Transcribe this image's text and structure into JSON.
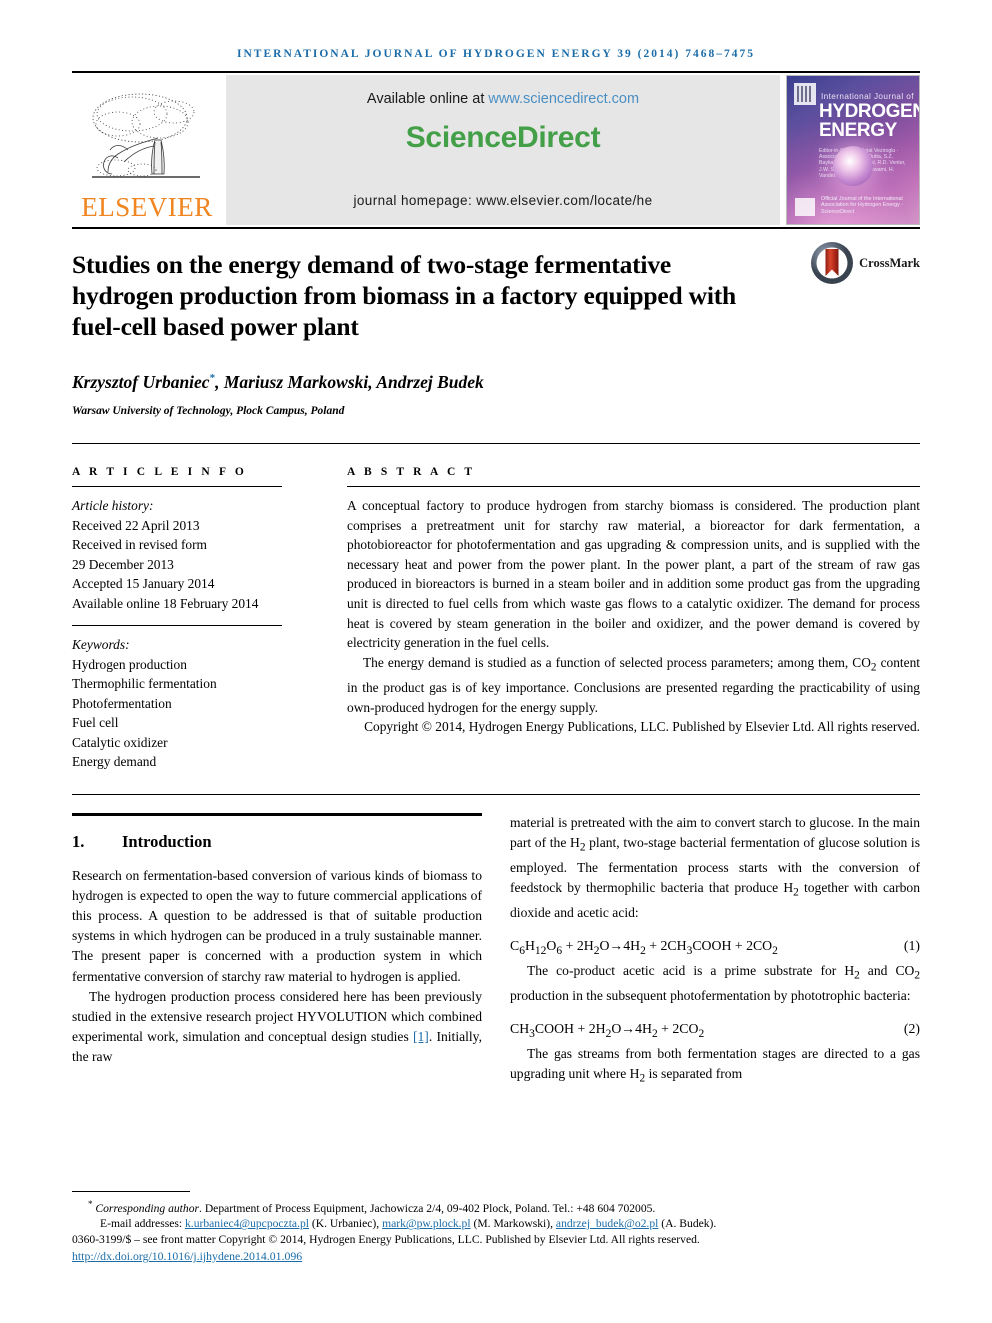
{
  "running_head": "INTERNATIONAL JOURNAL OF HYDROGEN ENERGY 39 (2014) 7468–7475",
  "masthead": {
    "publisher_word": "ELSEVIER",
    "available_prefix": "Available online at ",
    "available_url": "www.sciencedirect.com",
    "sciencedirect_logo": "ScienceDirect",
    "journal_homepage": "journal homepage: www.elsevier.com/locate/he",
    "cover": {
      "top_line": "International Journal of",
      "title_line1": "HYDROGEN",
      "title_line2": "ENERGY",
      "editors": "Editor-in-Chief: T. Nejat Veziroglu  ·  Associate Editors: S. Dutta, S.Z. Baykara, H.K. Abdel-Aal, R.D. Venter, J.W. Sheffield, D.Y. Goswami, H. Vandenborre",
      "footer": "Official Journal of the International Association for Hydrogen Energy  ·  ScienceDirect"
    }
  },
  "title": "Studies on the energy demand of two-stage fermentative hydrogen production from biomass in a factory equipped with fuel-cell based power plant",
  "crossmark_label": "CrossMark",
  "authors": "Krzysztof Urbaniec",
  "authors_rest": ", Mariusz Markowski, Andrzej Budek",
  "author_marker": "*",
  "affiliation": "Warsaw University of Technology, Plock Campus, Poland",
  "article_info": {
    "heading": "A R T I C L E   I N F O",
    "history_label": "Article history:",
    "history": [
      "Received 22 April 2013",
      "Received in revised form",
      "29 December 2013",
      "Accepted 15 January 2014",
      "Available online 18 February 2014"
    ],
    "keywords_label": "Keywords:",
    "keywords": [
      "Hydrogen production",
      "Thermophilic fermentation",
      "Photofermentation",
      "Fuel cell",
      "Catalytic oxidizer",
      "Energy demand"
    ]
  },
  "abstract": {
    "heading": "A B S T R A C T",
    "paragraph1": "A conceptual factory to produce hydrogen from starchy biomass is considered. The production plant comprises a pretreatment unit for starchy raw material, a bioreactor for dark fermentation, a photobioreactor for photofermentation and gas upgrading & compression units, and is supplied with the necessary heat and power from the power plant. In the power plant, a part of the stream of raw gas produced in bioreactors is burned in a steam boiler and in addition some product gas from the upgrading unit is directed to fuel cells from which waste gas flows to a catalytic oxidizer. The demand for process heat is covered by steam generation in the boiler and oxidizer, and the power demand is covered by electricity generation in the fuel cells.",
    "paragraph2_a": "The energy demand is studied as a function of selected process parameters; among them, CO",
    "paragraph2_sub": "2",
    "paragraph2_b": " content in the product gas is of key importance. Conclusions are presented regarding the practicability of using own-produced hydrogen for the energy supply.",
    "copyright": "Copyright © 2014, Hydrogen Energy Publications, LLC. Published by Elsevier Ltd. All rights reserved."
  },
  "body": {
    "section_number": "1.",
    "section_title": "Introduction",
    "left_p1": "Research on fermentation-based conversion of various kinds of biomass to hydrogen is expected to open the way to future commercial applications of this process. A question to be addressed is that of suitable production systems in which hydrogen can be produced in a truly sustainable manner. The present paper is concerned with a production system in which fermentative conversion of starchy raw material to hydrogen is applied.",
    "left_p2_a": "The hydrogen production process considered here has been previously studied in the extensive research project HYVOLUTION which combined experimental work, simulation and conceptual design studies ",
    "left_p2_ref": "[1]",
    "left_p2_b": ". Initially, the raw",
    "right_p1_a": "material is pretreated with the aim to convert starch to glucose. In the main part of the H",
    "right_p1_sub": "2",
    "right_p1_b": " plant, two-stage bacterial fermentation of glucose solution is employed. The fermentation process starts with the conversion of feedstock by thermophilic bacteria that produce H",
    "right_p1_sub2": "2",
    "right_p1_c": " together with carbon dioxide and acetic acid:",
    "equation1": "C6H12O6 + 2H2O → 4H2 + 2CH3COOH + 2CO2",
    "equation1_number": "(1)",
    "right_p2_a": "The co-product acetic acid is a prime substrate for H",
    "right_p2_sub": "2",
    "right_p2_b": " and CO",
    "right_p2_sub2": "2",
    "right_p2_c": " production in the subsequent photofermentation by phototrophic bacteria:",
    "equation2": "CH3COOH + 2H2O → 4H2 + 2CO2",
    "equation2_number": "(2)",
    "right_p3_a": "The gas streams from both fermentation stages are directed to a gas upgrading unit where H",
    "right_p3_sub": "2",
    "right_p3_b": " is separated from"
  },
  "footer": {
    "corr_marker": "*",
    "corr_label": "Corresponding author",
    "corr_rest": ". Department of Process Equipment, Jachowicza 2/4, 09-402 Plock, Poland. Tel.: +48 604 702005.",
    "email_label": "E-mail addresses: ",
    "email1": "k.urbaniec4@upcpoczta.pl",
    "email1_name": " (K. Urbaniec), ",
    "email2": "mark@pw.plock.pl",
    "email2_name": " (M. Markowski), ",
    "email3": "andrzej_budek@o2.pl",
    "email3_name": " (A. Budek).",
    "issn_line": "0360-3199/$ – see front matter Copyright © 2014, Hydrogen Energy Publications, LLC. Published by Elsevier Ltd. All rights reserved.",
    "doi": "http://dx.doi.org/10.1016/j.ijhydene.2014.01.096"
  },
  "colors": {
    "journal_blue": "#1B6CA8",
    "elsevier_orange": "#F08521",
    "sciencedirect_green": "#44A048",
    "link_blue": "#4A8FC4"
  }
}
